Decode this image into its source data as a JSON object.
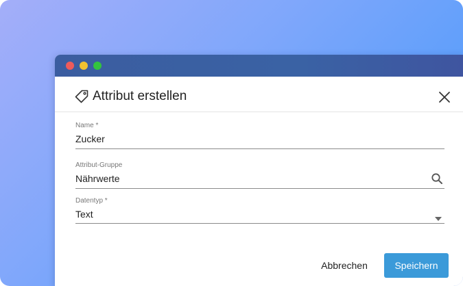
{
  "window": {
    "colors": {
      "accent": "#3b9ad9",
      "titlebar": "#3a5fa2",
      "traffic_red": "#ee5b5b",
      "traffic_yellow": "#f2c230",
      "traffic_green": "#33c43e"
    }
  },
  "dialog": {
    "title": "Attribut erstellen",
    "icon": "tag-icon",
    "close_icon": "close-icon"
  },
  "fields": {
    "name": {
      "label": "Name *",
      "value": "Zucker"
    },
    "group": {
      "label": "Attribut-Gruppe",
      "value": "Nährwerte",
      "icon": "search-icon"
    },
    "datatype": {
      "label": "Datentyp *",
      "value": "Text",
      "icon": "chevron-down-icon"
    }
  },
  "footer": {
    "cancel_label": "Abbrechen",
    "save_label": "Speichern"
  }
}
